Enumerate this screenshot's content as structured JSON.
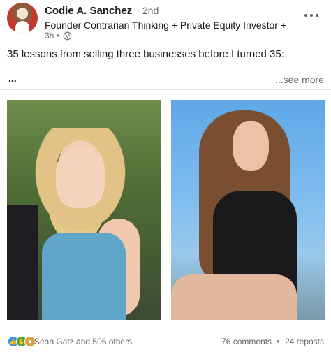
{
  "author": {
    "name": "Codie A. Sanchez",
    "degree": "2nd",
    "headline": "Founder Contrarian Thinking + Private Equity Investor + 2...",
    "time": "3h",
    "visibility_icon": "globe-icon"
  },
  "post": {
    "text": "35 lessons from selling three businesses before I turned 35:",
    "ellipsis": "...",
    "see_more": "...see more"
  },
  "images": [
    {
      "name": "photo-left"
    },
    {
      "name": "photo-right"
    }
  ],
  "social": {
    "reaction_icons": [
      "like-icon",
      "celebrate-icon",
      "support-icon"
    ],
    "reactions_label": "Sean Gatz and 506 others",
    "comments": "76 comments",
    "reposts": "24 reposts"
  },
  "colors": {
    "like": "#378fe9",
    "celebrate": "#44a23a",
    "support": "#d6a342",
    "text_primary": "#191919",
    "text_secondary": "#666666"
  }
}
